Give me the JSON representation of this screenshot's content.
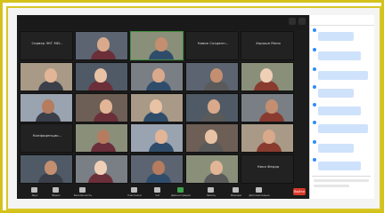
{
  "app": {
    "name": "Zoom",
    "accent": "#2d8cff",
    "end_color": "#d93a2b",
    "frame_color": "#d4c21b"
  },
  "tiles": [
    {
      "name": "Сервер ЭКГ МИ...",
      "kind": "name"
    },
    {
      "name": "",
      "kind": "photo",
      "caption": ""
    },
    {
      "name": "",
      "kind": "photo",
      "caption": "",
      "active": true
    },
    {
      "name": "Новое Созданн...",
      "kind": "name"
    },
    {
      "name": "Хороше Мело",
      "kind": "name"
    },
    {
      "name": "",
      "kind": "photo",
      "caption": ""
    },
    {
      "name": "",
      "kind": "photo",
      "caption": ""
    },
    {
      "name": "",
      "kind": "photo",
      "caption": ""
    },
    {
      "name": "",
      "kind": "photo",
      "caption": ""
    },
    {
      "name": "",
      "kind": "photo",
      "caption": ""
    },
    {
      "name": "",
      "kind": "photo",
      "caption": ""
    },
    {
      "name": "",
      "kind": "photo",
      "caption": ""
    },
    {
      "name": "",
      "kind": "photo",
      "caption": ""
    },
    {
      "name": "",
      "kind": "photo",
      "caption": ""
    },
    {
      "name": "",
      "kind": "photo",
      "caption": ""
    },
    {
      "name": "Конфиденцио...",
      "kind": "name"
    },
    {
      "name": "",
      "kind": "photo",
      "caption": ""
    },
    {
      "name": "",
      "kind": "photo",
      "caption": ""
    },
    {
      "name": "",
      "kind": "photo",
      "caption": ""
    },
    {
      "name": "",
      "kind": "photo",
      "caption": ""
    },
    {
      "name": "",
      "kind": "photo",
      "caption": ""
    },
    {
      "name": "",
      "kind": "photo",
      "caption": ""
    },
    {
      "name": "",
      "kind": "photo",
      "caption": ""
    },
    {
      "name": "",
      "kind": "photo",
      "caption": ""
    },
    {
      "name": "Ника Федор",
      "kind": "name"
    },
    {
      "name": "",
      "kind": "photo",
      "caption": ""
    },
    {
      "name": "Наталя Дмитри...",
      "kind": "name"
    },
    {
      "name": "",
      "kind": "photo",
      "caption": ""
    },
    {
      "name": "H",
      "kind": "letter",
      "caption": ""
    },
    {
      "name": "Елена Войска",
      "kind": "name"
    }
  ],
  "controls": [
    {
      "label": "Звук"
    },
    {
      "label": "Видео"
    },
    {
      "label": "Безопасность"
    },
    {
      "label": "Участники"
    },
    {
      "label": "Чат"
    },
    {
      "label": "Демонстрация"
    },
    {
      "label": "Запись"
    },
    {
      "label": "Реакции"
    },
    {
      "label": "Дополнительно"
    }
  ],
  "end_label": "Выйти",
  "chat_title": "Чат",
  "chat": {
    "messages": [
      {
        "sender": "",
        "lines": [
          "",
          ""
        ]
      },
      {
        "sender": "",
        "lines": [
          "",
          ""
        ]
      },
      {
        "sender": "",
        "lines": [
          "",
          ""
        ]
      },
      {
        "sender": "",
        "lines": [
          "",
          ""
        ]
      },
      {
        "sender": "",
        "lines": [
          "",
          ""
        ]
      },
      {
        "sender": "",
        "lines": [
          "",
          ""
        ]
      },
      {
        "sender": "",
        "lines": [
          "",
          ""
        ]
      },
      {
        "sender": "",
        "lines": [
          "",
          ""
        ]
      }
    ]
  }
}
